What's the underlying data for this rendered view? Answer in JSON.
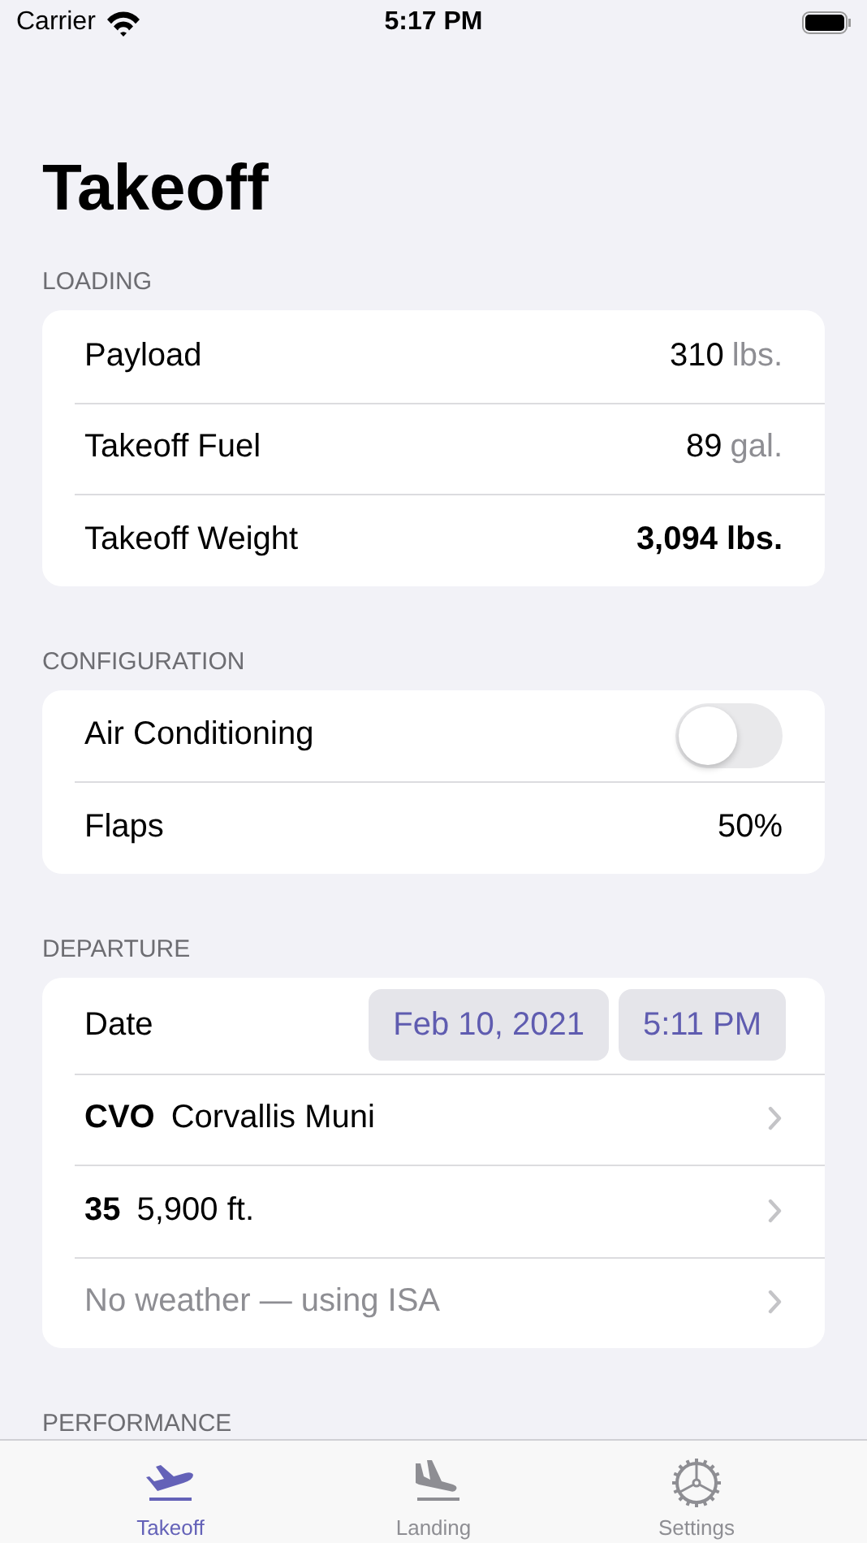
{
  "status_bar": {
    "carrier": "Carrier",
    "time": "5:17 PM"
  },
  "title": "Takeoff",
  "sections": [
    {
      "header": "LOADING",
      "rows": [
        {
          "kind": "measure",
          "label": "Payload",
          "value": "310",
          "unit": "lbs."
        },
        {
          "kind": "measure",
          "label": "Takeoff Fuel",
          "value": "89",
          "unit": "gal."
        },
        {
          "kind": "total",
          "label": "Takeoff Weight",
          "value": "3,094 lbs."
        }
      ]
    },
    {
      "header": "CONFIGURATION",
      "rows": [
        {
          "kind": "toggle",
          "label": "Air Conditioning",
          "on": false
        },
        {
          "kind": "value",
          "label": "Flaps",
          "value": "50%"
        }
      ]
    },
    {
      "header": "DEPARTURE",
      "rows": [
        {
          "kind": "datetime",
          "label": "Date",
          "date": "Feb 10, 2021",
          "time": "5:11 PM"
        },
        {
          "kind": "link",
          "code": "CVO",
          "text": "Corvallis Muni"
        },
        {
          "kind": "link",
          "code": "35",
          "text": "5,900 ft."
        },
        {
          "kind": "link",
          "placeholder": "No weather — using ISA"
        }
      ]
    },
    {
      "header": "PERFORMANCE"
    }
  ],
  "tab_bar": [
    {
      "label": "Takeoff",
      "kind": "takeoff",
      "selected": true
    },
    {
      "label": "Landing",
      "kind": "landing",
      "selected": false
    },
    {
      "label": "Settings",
      "kind": "settings",
      "selected": false
    }
  ]
}
